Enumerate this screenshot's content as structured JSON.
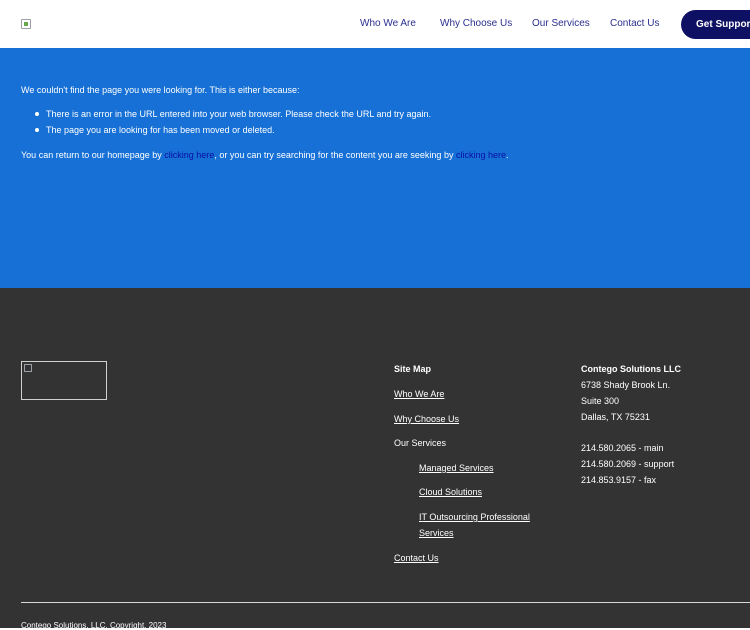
{
  "header": {
    "nav": [
      "Who We Are",
      "Why Choose Us",
      "Our Services",
      "Contact Us"
    ],
    "cta_label": "Get Support"
  },
  "error": {
    "intro": "We couldn't find the page you were looking for. This is either because:",
    "reasons": [
      "There is an error in the URL entered into your web browser. Please check the URL and try again.",
      "The page you are looking for has been moved or deleted."
    ],
    "return_prefix": "You can return to our homepage by ",
    "link1": "clicking here",
    "return_middle": ", or you can try searching for the content you are seeking by ",
    "link2": "clicking here",
    "return_suffix": "."
  },
  "footer": {
    "sitemap_title": "Site Map",
    "links": {
      "who": "Who We Are",
      "why": "Why Choose Us",
      "services": "Our Services",
      "managed": "Managed Services",
      "cloud": "Cloud Solutions",
      "it_line1": "IT Outsourcing Professional",
      "it_line2": "Services",
      "contact": "Contact Us"
    },
    "company": "Contego Solutions LLC",
    "address": [
      "6738 Shady Brook Ln.",
      "Suite 300",
      "Dallas, TX 75231"
    ],
    "phones": [
      "214.580.2065 - main",
      "214.580.2069 - support",
      "214.853.9157 - fax"
    ],
    "copyright": "Contego Solutions, LLC, Copyright, 2023"
  },
  "colors": {
    "hero_bg": "#1670d6",
    "nav_text": "#2b2f8f",
    "cta_bg": "#0e1063",
    "footer_bg": "#333333",
    "link": "#0b0fa3"
  }
}
